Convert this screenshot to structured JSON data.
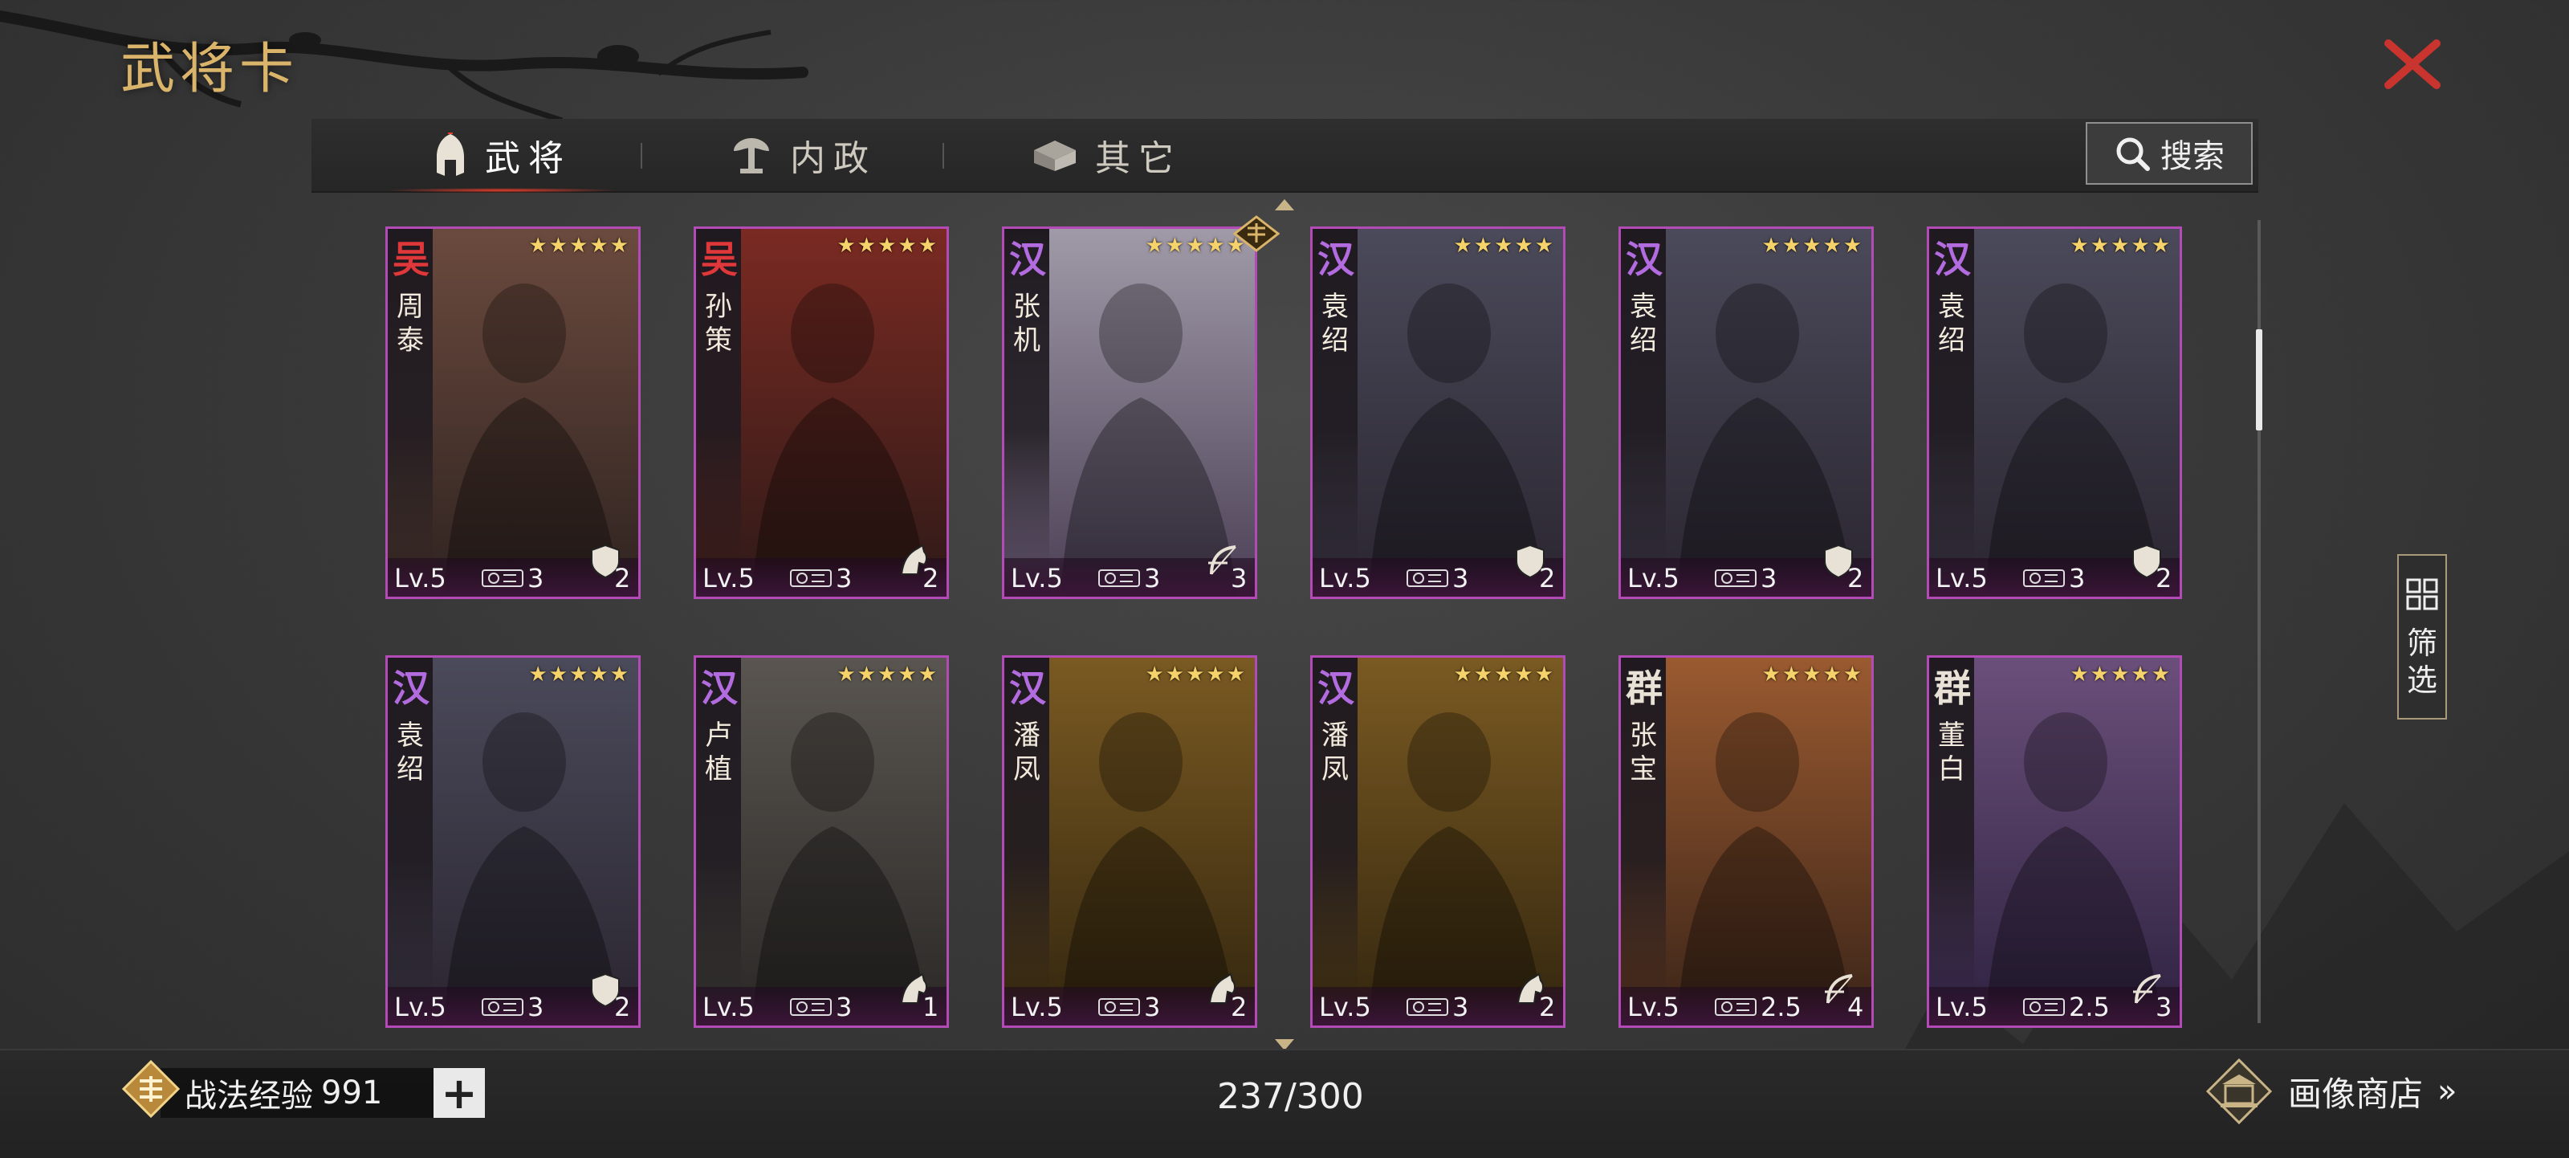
{
  "window": {
    "title": "武将卡"
  },
  "tabs": [
    {
      "label": "武将",
      "icon": "helmet-icon",
      "active": true
    },
    {
      "label": "内政",
      "icon": "tree-icon",
      "active": false
    },
    {
      "label": "其它",
      "icon": "chest-icon",
      "active": false
    }
  ],
  "search": {
    "label": "搜索",
    "icon": "search-icon"
  },
  "filter": {
    "label": "筛\n选",
    "icon": "grid-icon"
  },
  "cards": [
    {
      "faction": "吴",
      "name": "周\n泰",
      "stars": 5,
      "level": "Lv.5",
      "cost": "3",
      "troops": "2",
      "troop_icon": "shield-icon",
      "awakened": false
    },
    {
      "faction": "吴",
      "name": "孙\n策",
      "stars": 5,
      "level": "Lv.5",
      "cost": "3",
      "troops": "2",
      "troop_icon": "horse-icon",
      "awakened": false
    },
    {
      "faction": "汉",
      "name": "张\n机",
      "stars": 5,
      "level": "Lv.5",
      "cost": "3",
      "troops": "3",
      "troop_icon": "bow-icon",
      "awakened": true
    },
    {
      "faction": "汉",
      "name": "袁\n绍",
      "stars": 5,
      "level": "Lv.5",
      "cost": "3",
      "troops": "2",
      "troop_icon": "shield-icon",
      "awakened": false
    },
    {
      "faction": "汉",
      "name": "袁\n绍",
      "stars": 5,
      "level": "Lv.5",
      "cost": "3",
      "troops": "2",
      "troop_icon": "shield-icon",
      "awakened": false
    },
    {
      "faction": "汉",
      "name": "袁\n绍",
      "stars": 5,
      "level": "Lv.5",
      "cost": "3",
      "troops": "2",
      "troop_icon": "shield-icon",
      "awakened": false
    },
    {
      "faction": "汉",
      "name": "袁\n绍",
      "stars": 5,
      "level": "Lv.5",
      "cost": "3",
      "troops": "2",
      "troop_icon": "shield-icon",
      "awakened": false
    },
    {
      "faction": "汉",
      "name": "卢\n植",
      "stars": 5,
      "level": "Lv.5",
      "cost": "3",
      "troops": "1",
      "troop_icon": "horse-icon",
      "awakened": false
    },
    {
      "faction": "汉",
      "name": "潘\n凤",
      "stars": 5,
      "level": "Lv.5",
      "cost": "3",
      "troops": "2",
      "troop_icon": "horse-icon",
      "awakened": false
    },
    {
      "faction": "汉",
      "name": "潘\n凤",
      "stars": 5,
      "level": "Lv.5",
      "cost": "3",
      "troops": "2",
      "troop_icon": "horse-icon",
      "awakened": false
    },
    {
      "faction": "群",
      "name": "张\n宝",
      "stars": 5,
      "level": "Lv.5",
      "cost": "2.5",
      "troops": "4",
      "troop_icon": "bow-icon",
      "awakened": false
    },
    {
      "faction": "群",
      "name": "董\n白",
      "stars": 5,
      "level": "Lv.5",
      "cost": "2.5",
      "troops": "3",
      "troop_icon": "bow-icon",
      "awakened": false
    }
  ],
  "footer": {
    "exp_label": "战法经验",
    "exp_value": "991",
    "plus": "+",
    "count": "237/300",
    "shop_label": "画像商店",
    "shop_chevron": "»"
  },
  "colors": {
    "card_border": "#b24bb6",
    "wu": "#e0383a",
    "han": "#b36be0",
    "qun": "#e8e2d6",
    "title": "#d9b46a",
    "close": "#c9342e"
  }
}
